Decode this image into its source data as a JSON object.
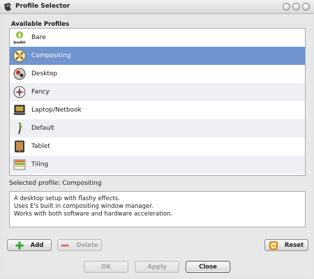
{
  "window": {
    "title": "Profile Selector"
  },
  "profiles": {
    "section_label": "Available Profiles",
    "items": [
      {
        "label": "Bare",
        "icon": "bodhi-logo-icon",
        "icon_text": "bodhi"
      },
      {
        "label": "Compositing",
        "icon": "compositing-icon",
        "selected": true
      },
      {
        "label": "Desktop",
        "icon": "desktop-icon"
      },
      {
        "label": "Fancy",
        "icon": "fancy-icon"
      },
      {
        "label": "Laptop/Netbook",
        "icon": "laptop-icon"
      },
      {
        "label": "Default",
        "icon": "default-icon"
      },
      {
        "label": "Tablet",
        "icon": "tablet-icon"
      },
      {
        "label": "Tiling",
        "icon": "tiling-icon"
      }
    ]
  },
  "selection": {
    "label": "Selected profile: Compositing"
  },
  "description": {
    "lines": [
      "A desktop setup with flashy effects.",
      "Uses E's built in compositing window manager.",
      "Works with both software and hardware acceleration."
    ]
  },
  "actions": {
    "add_label": "Add",
    "delete_label": "Delete",
    "reset_label": "Reset"
  },
  "dialog": {
    "ok_label": "OK",
    "apply_label": "Apply",
    "close_label": "Close"
  },
  "colors": {
    "selection": "#7094d0",
    "add_icon": "#2fa52f",
    "delete_icon": "#d97070",
    "reset_icon": "#e8a020"
  }
}
